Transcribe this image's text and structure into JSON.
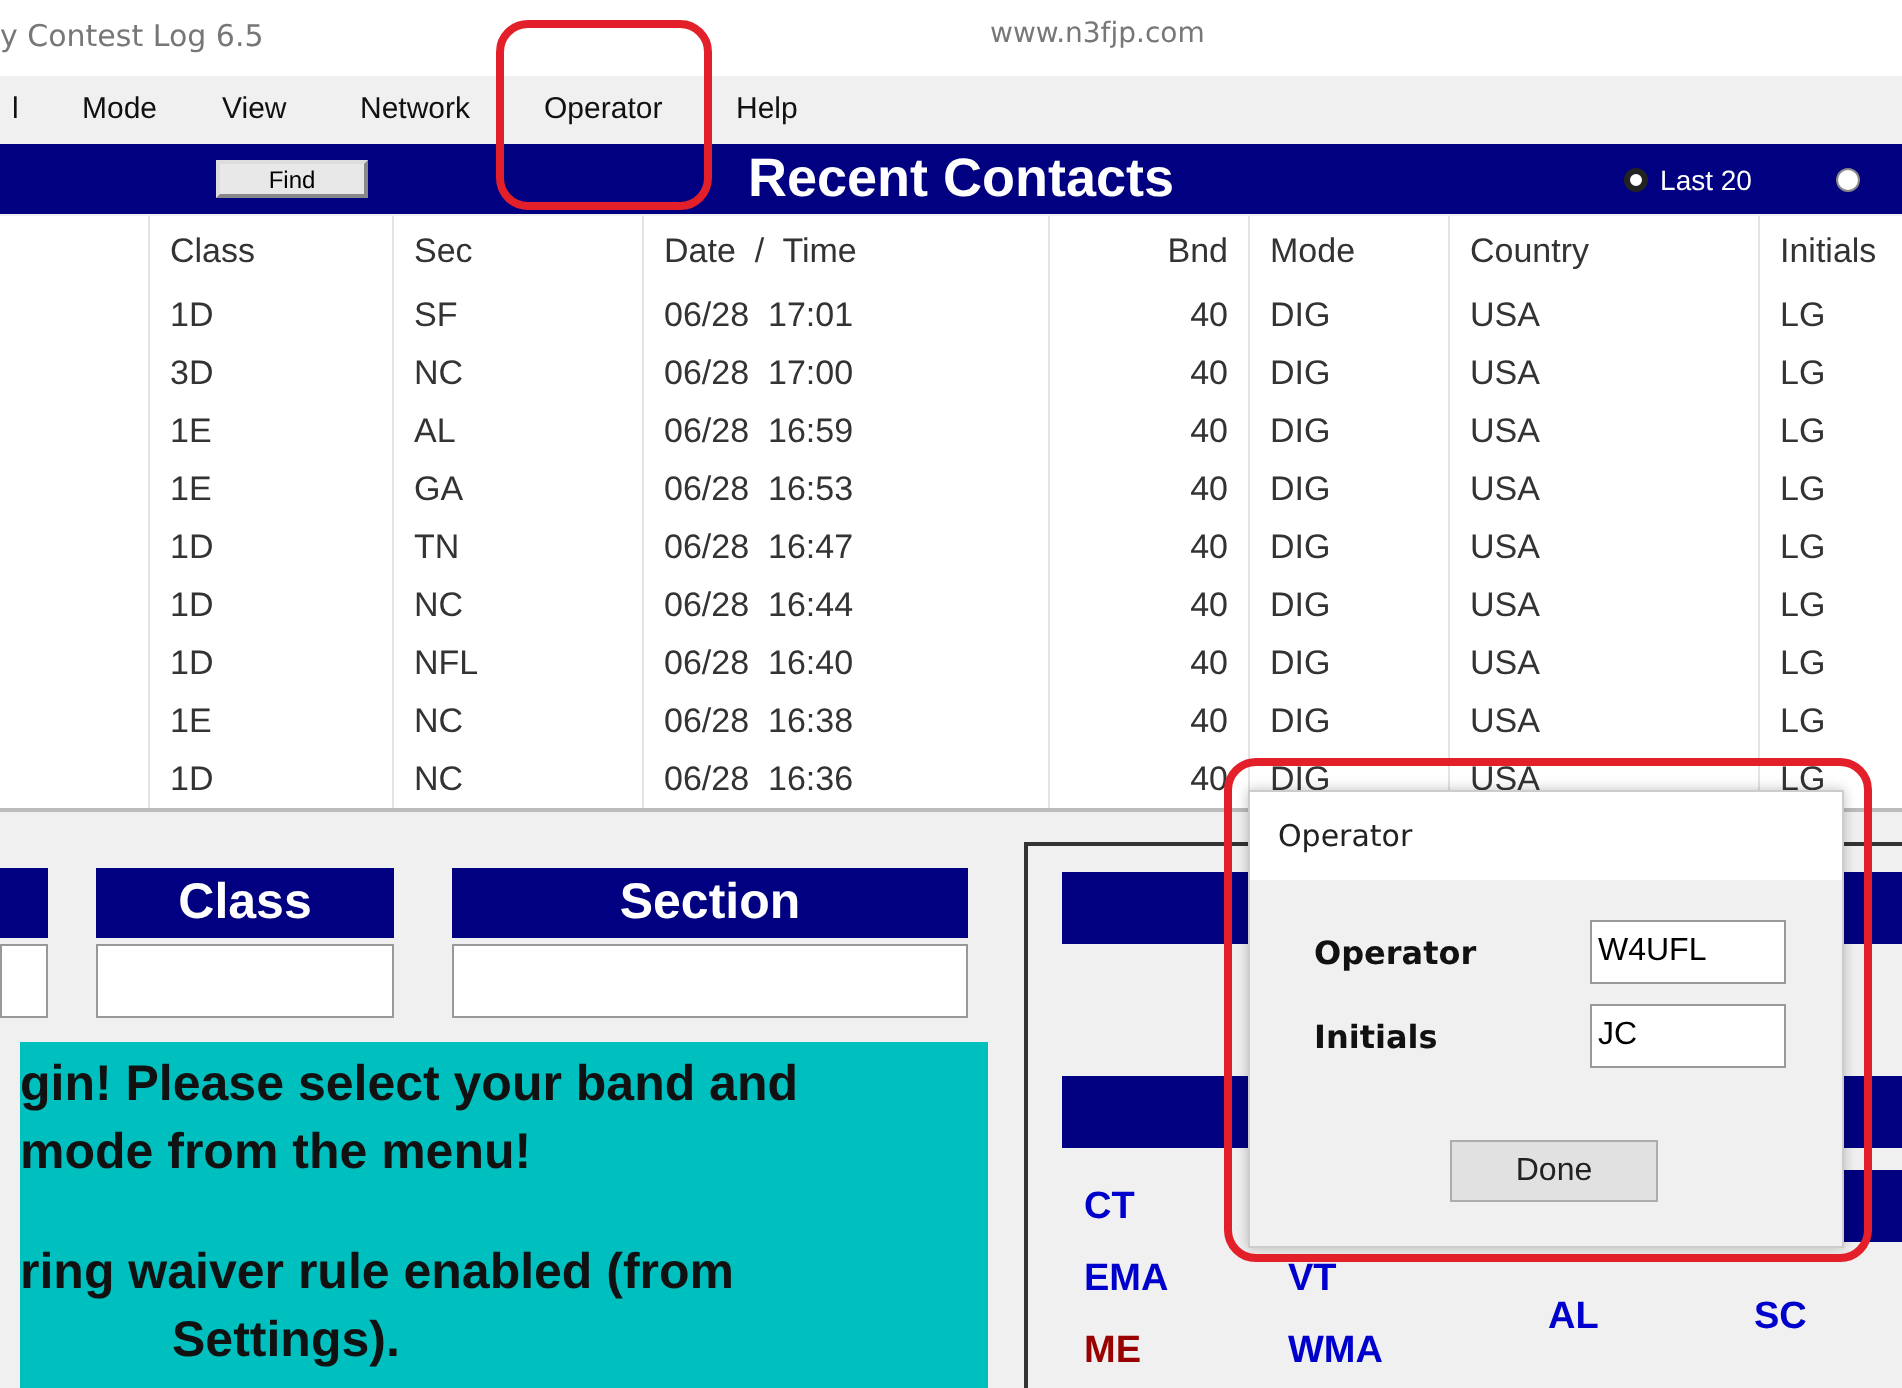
{
  "window": {
    "title": "y Contest Log 6.5",
    "url": "www.n3fjp.com"
  },
  "menu": [
    {
      "label": "l"
    },
    {
      "label": "Mode"
    },
    {
      "label": "View"
    },
    {
      "label": "Network"
    },
    {
      "label": "Operator"
    },
    {
      "label": "Help"
    }
  ],
  "recent": {
    "find_button": "Find",
    "title": "Recent Contacts",
    "options": [
      {
        "label": "Last 20",
        "selected": true
      },
      {
        "selected": false
      }
    ]
  },
  "table": {
    "columns": [
      "Class",
      "Sec",
      "Date  /  Time",
      "Bnd",
      "Mode",
      "Country",
      "Initials"
    ],
    "rows": [
      [
        "1D",
        "SF",
        "06/28  17:01",
        "40",
        "DIG",
        "USA",
        "LG"
      ],
      [
        "3D",
        "NC",
        "06/28  17:00",
        "40",
        "DIG",
        "USA",
        "LG"
      ],
      [
        "1E",
        "AL",
        "06/28  16:59",
        "40",
        "DIG",
        "USA",
        "LG"
      ],
      [
        "1E",
        "GA",
        "06/28  16:53",
        "40",
        "DIG",
        "USA",
        "LG"
      ],
      [
        "1D",
        "TN",
        "06/28  16:47",
        "40",
        "DIG",
        "USA",
        "LG"
      ],
      [
        "1D",
        "NC",
        "06/28  16:44",
        "40",
        "DIG",
        "USA",
        "LG"
      ],
      [
        "1D",
        "NFL",
        "06/28  16:40",
        "40",
        "DIG",
        "USA",
        "LG"
      ],
      [
        "1E",
        "NC",
        "06/28  16:38",
        "40",
        "DIG",
        "USA",
        "LG"
      ],
      [
        "1D",
        "NC",
        "06/28  16:36",
        "40",
        "DIG",
        "USA",
        "LG"
      ]
    ]
  },
  "entry": {
    "fields": [
      {
        "label": "Class"
      },
      {
        "label": "Section"
      }
    ]
  },
  "message": {
    "paragraphs": [
      [
        "gin!  Please select your band and",
        "mode from the menu!"
      ],
      [
        "ring waiver rule enabled (from",
        "Settings)."
      ]
    ]
  },
  "sections": {
    "left_columns": [
      [
        {
          "text": "CT",
          "color": "#0000cc"
        },
        {
          "text": "EMA",
          "color": "#0000cc"
        },
        {
          "text": "ME",
          "color": "#990000"
        }
      ],
      [
        {
          "text": "VT",
          "color": "#0000cc"
        },
        {
          "text": "WMA",
          "color": "#0000cc"
        }
      ]
    ],
    "right_columns": [
      [
        {
          "text": "AL",
          "color": "#0000cc"
        }
      ],
      [
        {
          "text": "SC",
          "color": "#0000cc"
        }
      ]
    ]
  },
  "dialog": {
    "title": "Operator",
    "annotated": true,
    "fields": [
      {
        "label": "Operator",
        "value": "W4UFL"
      },
      {
        "label": "Initials",
        "value": "JC"
      }
    ],
    "button": "Done"
  }
}
